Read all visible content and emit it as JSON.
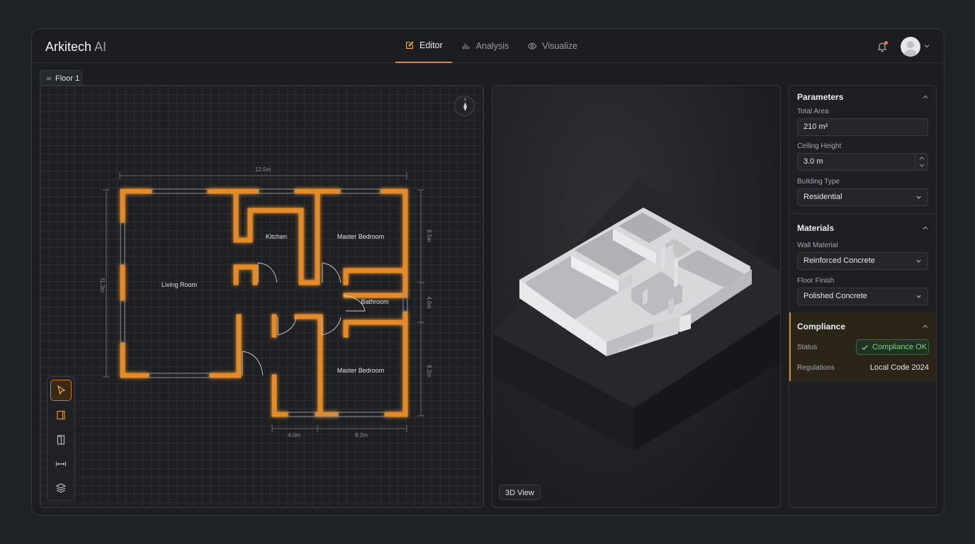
{
  "app": {
    "name": "Arkitech",
    "name_suffix": "AI"
  },
  "tabs": [
    {
      "label": "Editor",
      "icon": "edit-icon",
      "active": true
    },
    {
      "label": "Analysis",
      "icon": "bar-chart-icon",
      "active": false
    },
    {
      "label": "Visualize",
      "icon": "eye-icon",
      "active": false
    }
  ],
  "floor_tab": {
    "label": "Floor 1"
  },
  "plan": {
    "rooms": [
      "Living Room",
      "Kitchen",
      "Master Bedroom",
      "Bathroom",
      "Master Bedroom"
    ],
    "dimensions": {
      "top": "12.5m",
      "left": "f1.3m",
      "right_top": "8.5m",
      "right_mid": "4.0m",
      "right_bottom": "8.2m",
      "bottom_left": "4.0m",
      "bottom_right": "8.2m"
    },
    "compass_label": "N"
  },
  "tools": [
    {
      "name": "select-tool",
      "icon": "cursor-icon",
      "active": true
    },
    {
      "name": "wall-tool",
      "icon": "wall-icon",
      "active": false
    },
    {
      "name": "door-tool",
      "icon": "door-icon",
      "active": false
    },
    {
      "name": "measure-tool",
      "icon": "ruler-icon",
      "active": false
    },
    {
      "name": "layers-tool",
      "icon": "layers-icon",
      "active": false
    }
  ],
  "view3d": {
    "button_label": "3D View"
  },
  "panel": {
    "parameters": {
      "title": "Parameters",
      "total_area_label": "Total Area",
      "total_area_value": "210 m²",
      "ceiling_height_label": "Ceiling Height",
      "ceiling_height_value": "3.0 m",
      "building_type_label": "Building Type",
      "building_type_value": "Residential"
    },
    "materials": {
      "title": "Materials",
      "wall_material_label": "Wall Material",
      "wall_material_value": "Reinforced Concrete",
      "floor_finish_label": "Floor Finish",
      "floor_finish_value": "Polished Concrete"
    },
    "compliance": {
      "title": "Compliance",
      "status_label": "Status",
      "status_value": "Compliance OK",
      "regulations_label": "Regulations",
      "regulations_value": "Local Code 2024"
    }
  },
  "colors": {
    "accent": "#d98a2b",
    "wall_glow": "#e38b2c",
    "ok_green": "#7fd27a"
  }
}
